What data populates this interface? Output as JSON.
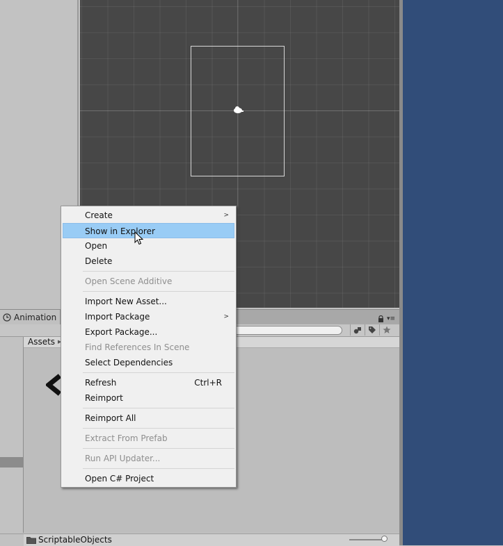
{
  "tabs": {
    "animation": "Animation"
  },
  "project": {
    "breadcrumb": "Assets",
    "current_folder": "ScriptableObjects"
  },
  "context_menu": {
    "items": [
      {
        "label": "Create",
        "submenu": true
      },
      {
        "label": "Show in Explorer",
        "highlighted": true
      },
      {
        "label": "Open"
      },
      {
        "label": "Delete"
      },
      {
        "label": "Open Scene Additive",
        "disabled": true
      },
      {
        "label": "Import New Asset..."
      },
      {
        "label": "Import Package",
        "submenu": true
      },
      {
        "label": "Export Package..."
      },
      {
        "label": "Find References In Scene",
        "disabled": true
      },
      {
        "label": "Select Dependencies"
      },
      {
        "label": "Refresh",
        "shortcut": "Ctrl+R"
      },
      {
        "label": "Reimport"
      },
      {
        "label": "Reimport All"
      },
      {
        "label": "Extract From Prefab",
        "disabled": true
      },
      {
        "label": "Run API Updater...",
        "disabled": true
      },
      {
        "label": "Open C# Project"
      }
    ]
  },
  "colors": {
    "scene_background": "#474747",
    "menu_highlight": "#99ccf5",
    "right_panel": "#314d79"
  },
  "icons": {
    "submenu_arrow": "chevron-right-icon",
    "lock": "lock-icon",
    "folder": "folder-icon",
    "cursor": "mouse-pointer-icon"
  }
}
